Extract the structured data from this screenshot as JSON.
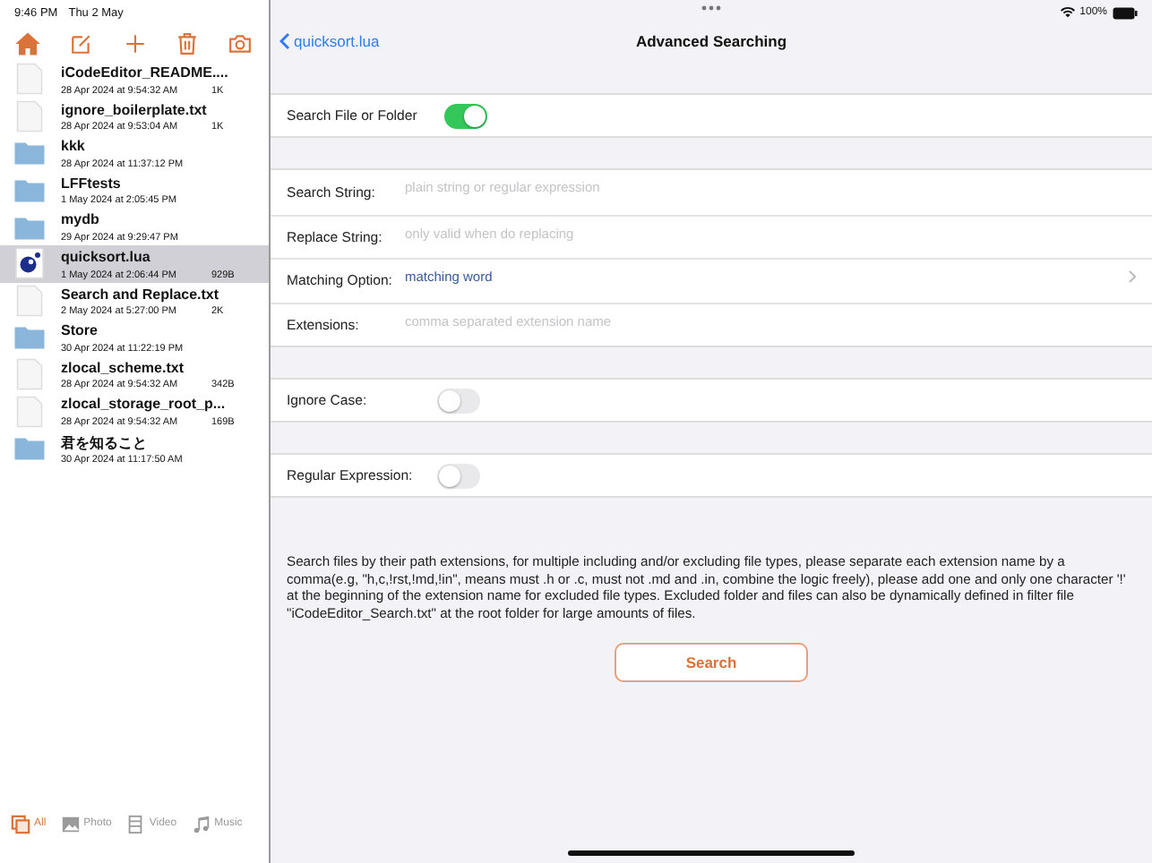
{
  "status_bar": {
    "time": "9:46 PM",
    "date": "Thu 2 May",
    "battery": "100%"
  },
  "files": [
    {
      "name": "iCodeEditor_README....",
      "date": "28 Apr 2024 at 9:54:32 AM",
      "size": "1K",
      "kind": "file",
      "selected": false
    },
    {
      "name": "ignore_boilerplate.txt",
      "date": "28 Apr 2024 at 9:53:04 AM",
      "size": "1K",
      "kind": "file",
      "selected": false
    },
    {
      "name": "kkk",
      "date": "28 Apr 2024 at 11:37:12 PM",
      "kind": "folder",
      "selected": false
    },
    {
      "name": "LFFtests",
      "date": "1 May 2024 at 2:05:45 PM",
      "kind": "folder",
      "selected": false
    },
    {
      "name": "mydb",
      "date": "29 Apr 2024 at 9:29:47 PM",
      "kind": "folder",
      "selected": false
    },
    {
      "name": "quicksort.lua",
      "date": "1 May 2024 at 2:06:44 PM",
      "size": "929B",
      "kind": "lua",
      "selected": true
    },
    {
      "name": "Search and Replace.txt",
      "date": "2 May 2024 at 5:27:00 PM",
      "size": "2K",
      "kind": "file",
      "selected": false
    },
    {
      "name": "Store",
      "date": "30 Apr 2024 at 11:22:19 PM",
      "kind": "folder",
      "selected": false
    },
    {
      "name": "zlocal_scheme.txt",
      "date": "28 Apr 2024 at 9:54:32 AM",
      "size": "342B",
      "kind": "file",
      "selected": false
    },
    {
      "name": "zlocal_storage_root_p...",
      "date": "28 Apr 2024 at 9:54:32 AM",
      "size": "169B",
      "kind": "file",
      "selected": false
    },
    {
      "name": "君を知ること",
      "date": "30 Apr 2024 at 11:17:50 AM",
      "kind": "folder",
      "selected": false
    }
  ],
  "bottom_tabs": [
    {
      "label": "All",
      "kind": "all",
      "selected": true
    },
    {
      "label": "Photo",
      "kind": "photo",
      "selected": false
    },
    {
      "label": "Video",
      "kind": "video",
      "selected": false
    },
    {
      "label": "Music",
      "kind": "music",
      "selected": false
    }
  ],
  "nav": {
    "back": "quicksort.lua",
    "title": "Advanced Searching"
  },
  "search_toggle": {
    "label": "Search File or Folder",
    "on": true
  },
  "fields": [
    {
      "label": "Search String:",
      "placeholder": "plain string or regular expression",
      "kind": "text"
    },
    {
      "label": "Replace String:",
      "placeholder": "only valid when do replacing",
      "kind": "text"
    },
    {
      "label": "Matching Option:",
      "value": "matching word",
      "kind": "picker"
    },
    {
      "label": "Extensions:",
      "placeholder": "comma separated extension name",
      "kind": "text"
    }
  ],
  "switches": [
    {
      "label": "Ignore Case:",
      "on": false
    },
    {
      "label": "Regular Expression:",
      "on": false
    }
  ],
  "description": "Search files by their path extensions, for multiple including and/or excluding file types, please separate each extension name by a comma(e.g, \"h,c,!rst,!md,!in\", means must .h or .c, must not .md and .in, combine the logic freely), please add one and only one character '!' at the beginning of the extension name for excluded file types. Excluded folder and files can also be dynamically defined in filter file \"iCodeEditor_Search.txt\" at the root folder for large amounts of files.",
  "button": "Search"
}
